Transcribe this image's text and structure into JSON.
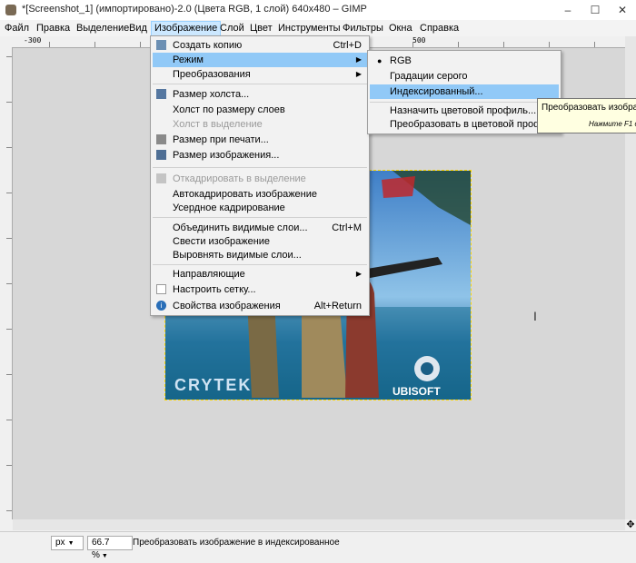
{
  "window": {
    "title": "*[Screenshot_1] (импортировано)-2.0 (Цвета RGB, 1 слой) 640x480 – GIMP",
    "minimize_glyph": "–",
    "maximize_glyph": "☐",
    "close_glyph": "✕"
  },
  "menubar": [
    {
      "label": "Файл"
    },
    {
      "label": "Правка"
    },
    {
      "label": "Выделение"
    },
    {
      "label": "Вид"
    },
    {
      "label": "Изображение"
    },
    {
      "label": "Слой"
    },
    {
      "label": "Цвет"
    },
    {
      "label": "Инструменты"
    },
    {
      "label": "Фильтры"
    },
    {
      "label": "Окна"
    },
    {
      "label": "Справка"
    }
  ],
  "rulers": {
    "top_labels": [
      "-300",
      "500"
    ]
  },
  "image_menu": {
    "items": [
      {
        "label": "Создать копию",
        "shortcut": "Ctrl+D",
        "icon": "duplicate-icon"
      },
      {
        "label": "Режим",
        "submenu": true
      },
      {
        "label": "Преобразования",
        "submenu": true
      },
      {
        "label": "Размер холста...",
        "icon": "canvas-size-icon"
      },
      {
        "label": "Холст по размеру слоев"
      },
      {
        "label": "Холст в выделение",
        "disabled": true
      },
      {
        "label": "Размер при печати...",
        "icon": "print-size-icon"
      },
      {
        "label": "Размер изображения...",
        "icon": "scale-image-icon"
      },
      {
        "label": "Откадрировать в выделение",
        "disabled": true,
        "icon": "crop-icon"
      },
      {
        "label": "Автокадрировать изображение"
      },
      {
        "label": "Усердное кадрирование"
      },
      {
        "label": "Объединить видимые слои...",
        "shortcut": "Ctrl+M"
      },
      {
        "label": "Свести изображение"
      },
      {
        "label": "Выровнять видимые слои..."
      },
      {
        "label": "Направляющие",
        "submenu": true
      },
      {
        "label": "Настроить сетку...",
        "icon": "grid-icon"
      },
      {
        "label": "Свойства изображения",
        "shortcut": "Alt+Return",
        "icon": "info-icon"
      }
    ]
  },
  "mode_submenu": {
    "items": [
      {
        "label": "RGB",
        "checked": true
      },
      {
        "label": "Градации серого"
      },
      {
        "label": "Индексированный..."
      },
      {
        "label": "Назначить цветовой профиль..."
      },
      {
        "label": "Преобразовать в цветовой профиль"
      }
    ]
  },
  "tooltip": {
    "text": "Преобразовать изобра",
    "hint": "Нажмите F1 д"
  },
  "image_content": {
    "logo_left": "CRYTEK",
    "logo_right": "UBISOFT"
  },
  "statusbar": {
    "unit": "px",
    "zoom": "66.7 %",
    "message": "Преобразовать изображение в индексированное"
  }
}
